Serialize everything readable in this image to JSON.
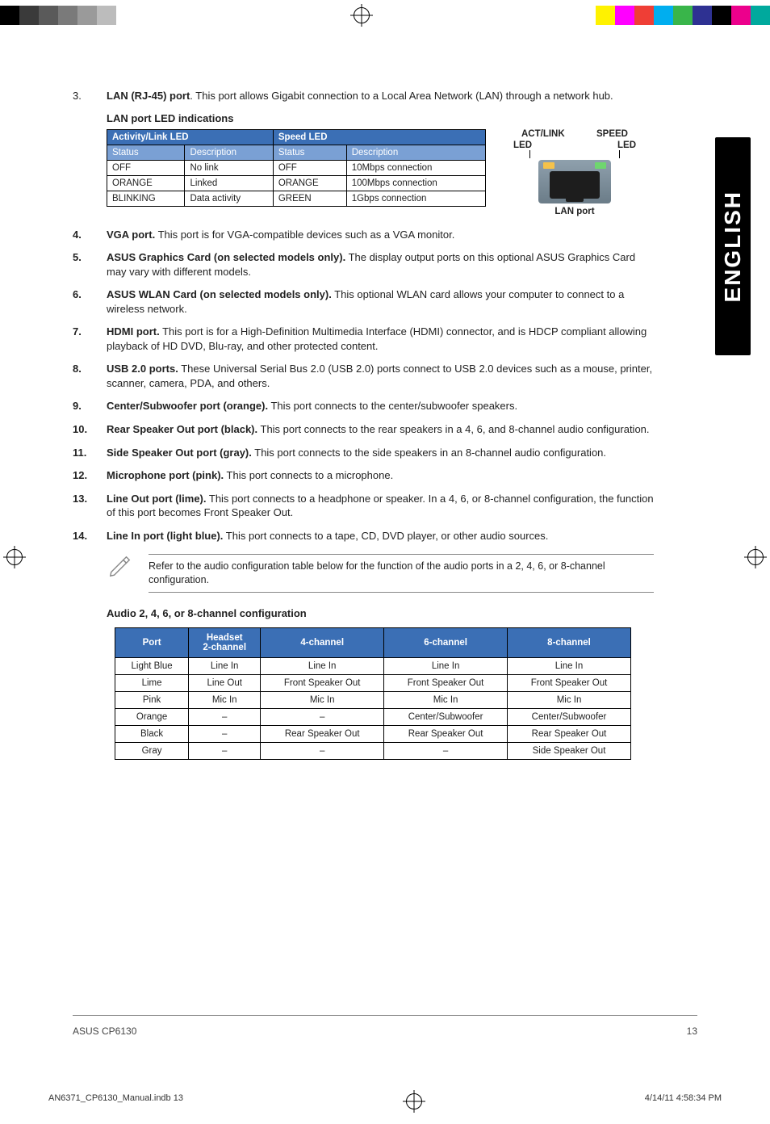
{
  "reg_colors_left": [
    "#000000",
    "#3a3a3a",
    "#5a5a5a",
    "#7a7a7a",
    "#9a9a9a",
    "#bcbcbc",
    "#ffffff"
  ],
  "reg_colors_right": [
    "#ffffff",
    "#fff200",
    "#ff00ff",
    "#ef3e36",
    "#00aeef",
    "#39b54a",
    "#2e3192",
    "#000000",
    "#ec008c",
    "#00a99d"
  ],
  "item3": {
    "num": "3.",
    "bold": "LAN (RJ-45) port",
    "text": ". This port allows Gigabit connection to a Local Area Network (LAN) through a network hub."
  },
  "led_heading": "LAN port LED indications",
  "lan_labels": {
    "top_left": "ACT/LINK",
    "top_right": "SPEED",
    "led": "LED",
    "caption": "LAN port"
  },
  "led_table": {
    "grp1": "Activity/Link LED",
    "grp2": "Speed LED",
    "sub": [
      "Status",
      "Description",
      "Status",
      "Description"
    ],
    "rows": [
      [
        "OFF",
        "No link",
        "OFF",
        "10Mbps connection"
      ],
      [
        "ORANGE",
        "Linked",
        "ORANGE",
        "100Mbps connection"
      ],
      [
        "BLINKING",
        "Data activity",
        "GREEN",
        "1Gbps connection"
      ]
    ]
  },
  "side_tab": "ENGLISH",
  "items": [
    {
      "num": "4.",
      "bold": "VGA port.",
      "text": " This port is for VGA-compatible devices such as a VGA monitor."
    },
    {
      "num": "5.",
      "bold": "ASUS Graphics Card (on selected models only).",
      "text": " The display output ports on this optional ASUS Graphics Card may vary with different models."
    },
    {
      "num": "6.",
      "bold": "ASUS WLAN Card (on selected models only).",
      "text": " This optional WLAN card allows your computer to connect to a wireless network."
    },
    {
      "num": "7.",
      "bold": "HDMI port.",
      "text": " This port is for a High-Definition Multimedia Interface (HDMI) connector, and is HDCP compliant allowing playback of HD DVD, Blu-ray, and other protected content."
    },
    {
      "num": "8.",
      "bold": "USB 2.0 ports.",
      "text": " These Universal Serial Bus 2.0 (USB 2.0) ports connect to USB 2.0 devices such as a mouse, printer, scanner, camera, PDA, and others."
    },
    {
      "num": "9.",
      "bold": "Center/Subwoofer port (orange).",
      "text": " This port connects to the center/subwoofer speakers."
    },
    {
      "num": "10.",
      "bold": "Rear Speaker Out port (black).",
      "text": " This port connects to the rear speakers in a 4, 6, and 8-channel audio configuration."
    },
    {
      "num": "11.",
      "bold": "Side Speaker Out port (gray).",
      "text": " This port connects to the side speakers in an 8-channel audio configuration."
    },
    {
      "num": "12.",
      "bold": "Microphone port (pink).",
      "text": " This port connects to a microphone."
    },
    {
      "num": "13.",
      "bold": "Line Out port (lime).",
      "text": " This port connects to a headphone or speaker. In a 4, 6, or 8-channel configuration, the function of this port becomes Front Speaker Out."
    },
    {
      "num": "14.",
      "bold": "Line In port (light blue).",
      "text": " This port connects to a tape, CD, DVD player, or other audio sources."
    }
  ],
  "note_text": "Refer to the audio configuration table below for the function of the audio ports in a 2, 4, 6, or 8-channel configuration.",
  "audio_heading": "Audio 2, 4, 6, or 8-channel configuration",
  "audio_table": {
    "headers": [
      "Port",
      "Headset 2-channel",
      "4-channel",
      "6-channel",
      "8-channel"
    ],
    "rows": [
      [
        "Light Blue",
        "Line In",
        "Line In",
        "Line In",
        "Line In"
      ],
      [
        "Lime",
        "Line Out",
        "Front Speaker Out",
        "Front Speaker Out",
        "Front Speaker Out"
      ],
      [
        "Pink",
        "Mic In",
        "Mic In",
        "Mic In",
        "Mic In"
      ],
      [
        "Orange",
        "–",
        "–",
        "Center/Subwoofer",
        "Center/Subwoofer"
      ],
      [
        "Black",
        "–",
        "Rear Speaker Out",
        "Rear Speaker Out",
        "Rear Speaker Out"
      ],
      [
        "Gray",
        "–",
        "–",
        "–",
        "Side Speaker Out"
      ]
    ]
  },
  "footer": {
    "model": "ASUS CP6130",
    "page": "13"
  },
  "job": {
    "file": "AN6371_CP6130_Manual.indb   13",
    "stamp": "4/14/11   4:58:34 PM"
  }
}
